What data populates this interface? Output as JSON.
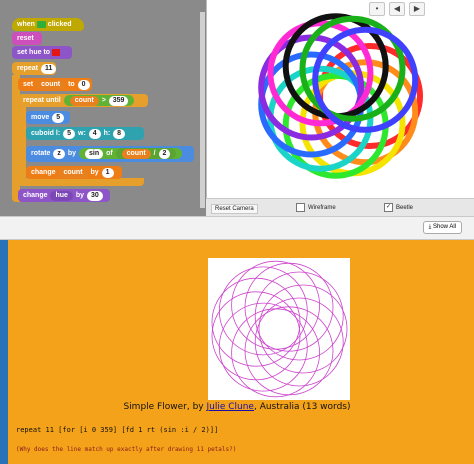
{
  "stage": {
    "tools": [
      "•",
      "◀",
      "▶"
    ],
    "toolbar": {
      "reset_camera": "Reset Camera",
      "wireframe": "Wireframe",
      "beetle": "Beetle",
      "wireframe_checked": false,
      "beetle_checked": true
    }
  },
  "blocks": {
    "when_clicked": "when",
    "when_clicked_suffix": "clicked",
    "reset": "reset",
    "set_hue": "set hue to",
    "repeat": "repeat",
    "repeat_n": "11",
    "set_count": "set",
    "set_count_var": "count",
    "set_count_to": "to",
    "set_count_val": "0",
    "repeat_until": "repeat until",
    "until_var": "count",
    "until_op": ">",
    "until_val": "359",
    "move": "move",
    "move_val": "5",
    "cuboid": "cuboid",
    "cuboid_l_label": "l:",
    "cuboid_l": "5",
    "cuboid_w_label": "w:",
    "cuboid_w": "4",
    "cuboid_h_label": "h:",
    "cuboid_h": "8",
    "rotate": "rotate",
    "rotate_axis": "z",
    "rotate_by": "by",
    "rotate_fn": "sin",
    "rotate_of": "of",
    "rotate_var": "count",
    "rotate_div": "/",
    "rotate_den": "2",
    "change_count": "change",
    "change_count_var": "count",
    "change_count_by": "by",
    "change_count_val": "1",
    "change_hue": "change",
    "change_hue_var": "hue",
    "change_hue_by": "by",
    "change_hue_val": "30"
  },
  "divider": {
    "show_all": "Show All"
  },
  "page": {
    "caption_prefix": "Simple Flower, by ",
    "caption_author": "Julie Clune",
    "caption_suffix": ", Australia (13 words)",
    "code": "repeat 11 [for [i 0 359] [fd 1 rt (sin :i / 2)]]",
    "question": "(Why does the line match up exactly after drawing 11 petals?)"
  },
  "colors": {
    "page_bg": "#f4a21a",
    "flower_stroke": "#cc44cc"
  }
}
